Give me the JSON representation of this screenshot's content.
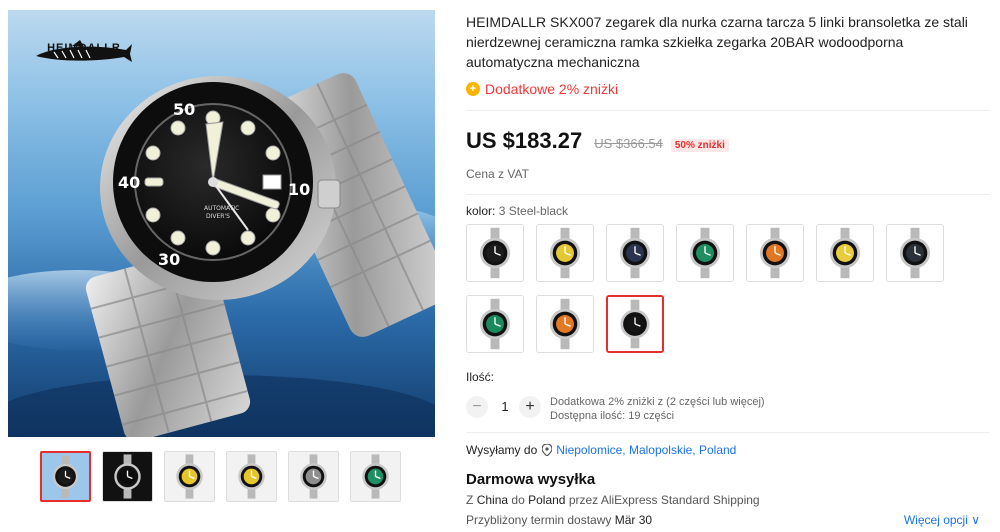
{
  "gallery": {
    "brand": "HEIMDALLR",
    "bezel_numbers": [
      "50",
      "40",
      "30",
      "10"
    ],
    "dial_text": [
      "AUTOMATIC",
      "DIVER'S"
    ],
    "thumbnails": [
      {
        "name": "black-dial",
        "dial": "#1a1a1a",
        "bg": "#9cc7ea"
      },
      {
        "name": "lume-night",
        "dial": "#0c0c0c",
        "bg": "#111111"
      },
      {
        "name": "yellow-dial",
        "dial": "#e6c62a",
        "bg": "#f2f2f2"
      },
      {
        "name": "yellow-dial-2",
        "dial": "#e6c62a",
        "bg": "#f2f2f2"
      },
      {
        "name": "bracelet-detail",
        "dial": "#8e8e8e",
        "bg": "#f2f2f2"
      },
      {
        "name": "color-lineup",
        "dial": "#1f8f63",
        "bg": "#f2f2f2"
      }
    ]
  },
  "product": {
    "title": "HEIMDALLR SKX007 zegarek dla nurka czarna tarcza 5 linki bransoletka ze stali nierdzewnej ceramiczna ramka szkiełka zegarka 20BAR wodoodporna automatyczna mechaniczna",
    "extra_discount": "Dodatkowe 2% zniżki",
    "price": "US $183.27",
    "old_price": "US $366.54",
    "discount_badge": "50% zniżki",
    "vat": "Cena z VAT",
    "color_label": "kolor:",
    "color_value": "3 Steel-black"
  },
  "swatches": [
    {
      "name": "black-1",
      "dial": "#1c1c1c"
    },
    {
      "name": "yellow-1",
      "dial": "#e3c733"
    },
    {
      "name": "navy",
      "dial": "#2a3450"
    },
    {
      "name": "green-1",
      "dial": "#1f8f63"
    },
    {
      "name": "orange-1",
      "dial": "#e07722"
    },
    {
      "name": "yellow-2",
      "dial": "#e8cc3a"
    },
    {
      "name": "dark-gray",
      "dial": "#2b3138"
    },
    {
      "name": "green-2",
      "dial": "#1a8a5e"
    },
    {
      "name": "orange-2",
      "dial": "#e27a24"
    },
    {
      "name": "steel-black",
      "dial": "#151515"
    }
  ],
  "quantity": {
    "label": "Ilość:",
    "minus": "−",
    "value": "1",
    "plus": "+",
    "note_line1": "Dodatkowa 2% zniżki z (2 części lub więcej)",
    "note_line2": "Dostępna ilość: 19 części"
  },
  "shipping": {
    "ship_to_label": "Wysyłamy do",
    "location": "Niepolomice, Malopolskie, Poland",
    "free_shipping": "Darmowa wysyłka",
    "route_prefix": "Z",
    "origin": "China",
    "route_mid": "do",
    "destination": "Poland",
    "route_suffix": "przez AliExpress Standard Shipping",
    "eta_label": "Przybliżony termin dostawy",
    "eta_date": "Mär 30",
    "more_options": "Więcej opcji ∨"
  },
  "colors": {
    "accent_red": "#e62e2e",
    "link_blue": "#1a73e8",
    "coin_gold": "#f7b500"
  }
}
